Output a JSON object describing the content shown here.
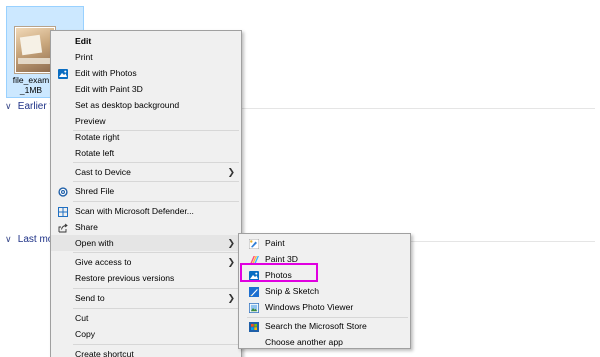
{
  "file": {
    "name_line1": "file_exam",
    "name_line2": "_1MB",
    "thumb_caption": "file image"
  },
  "groups": {
    "earlier": "Earlier t",
    "last": "Last mo"
  },
  "context_menu": {
    "edit": "Edit",
    "print": "Print",
    "edit_with_photos": "Edit with Photos",
    "edit_with_paint3d": "Edit with Paint 3D",
    "set_desktop_bg": "Set as desktop background",
    "preview": "Preview",
    "rotate_right": "Rotate right",
    "rotate_left": "Rotate left",
    "cast_to_device": "Cast to Device",
    "shred_file": "Shred File",
    "scan_defender": "Scan with Microsoft Defender...",
    "share": "Share",
    "open_with": "Open with",
    "give_access_to": "Give access to",
    "restore_previous": "Restore previous versions",
    "send_to": "Send to",
    "cut": "Cut",
    "copy": "Copy",
    "create_shortcut": "Create shortcut"
  },
  "open_with_menu": {
    "paint": "Paint",
    "paint3d": "Paint 3D",
    "photos": "Photos",
    "snip_sketch": "Snip & Sketch",
    "photo_viewer": "Windows Photo Viewer",
    "search_store": "Search the Microsoft Store",
    "choose_another": "Choose another app"
  },
  "colors": {
    "menu_bg": "#f0f0f0",
    "selection": "#cce8ff",
    "highlight_outline": "#e000e0",
    "group_header": "#1e3287"
  },
  "icons": {
    "edit_with_photos": "photos-icon",
    "shred_file": "shred-icon",
    "scan_defender": "defender-icon",
    "share": "share-icon",
    "paint": "paint-icon",
    "paint3d": "paint3d-icon",
    "photos": "photos-icon",
    "snip_sketch": "snip-sketch-icon",
    "photo_viewer": "photo-viewer-icon",
    "search_store": "store-icon",
    "submenu_arrow": "chevron-right-icon"
  }
}
